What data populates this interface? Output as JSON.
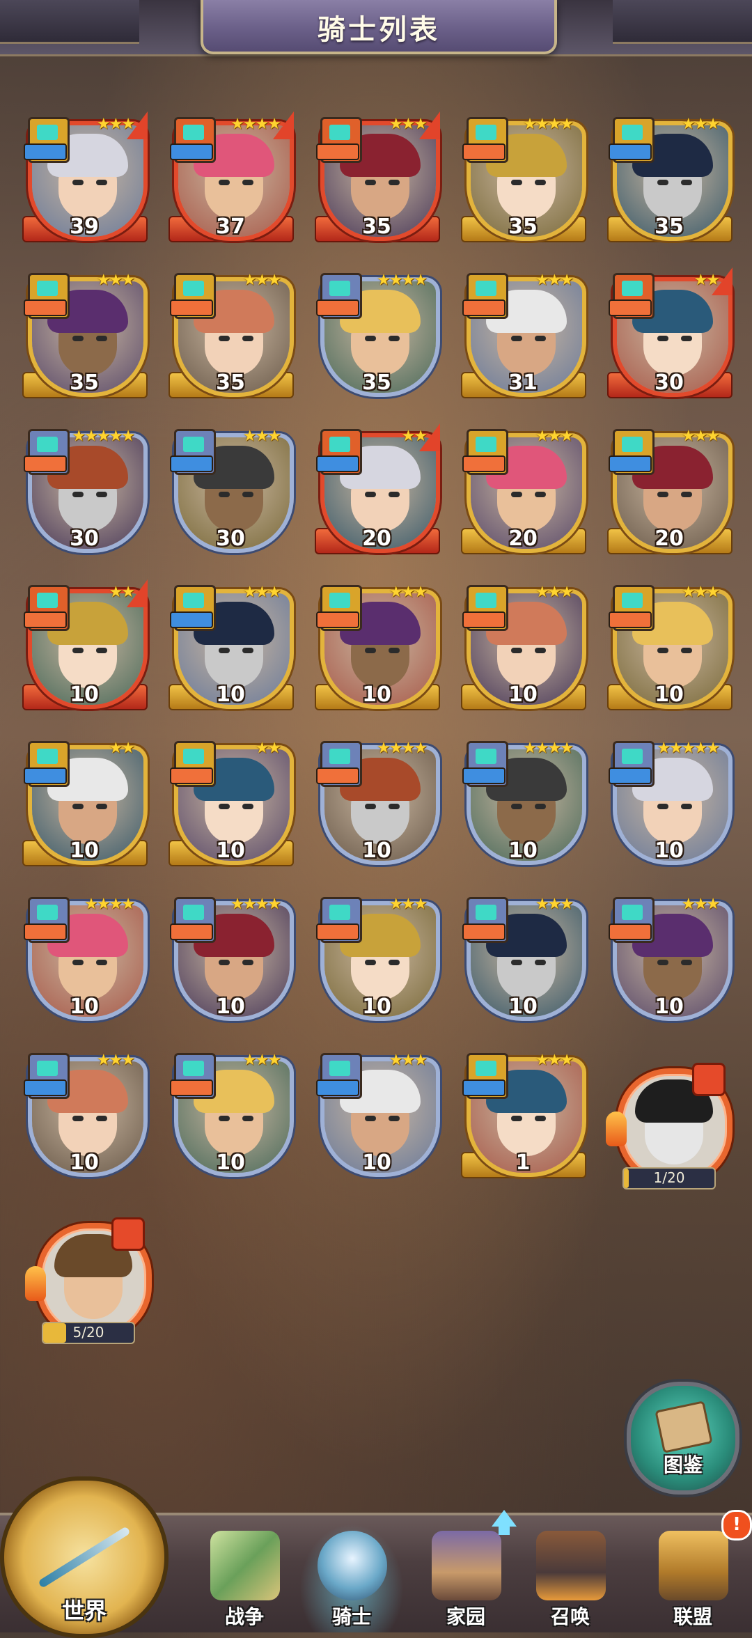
{
  "header": {
    "title": "骑士列表"
  },
  "colors": {
    "class_teal": "#3fd9c6",
    "tab_red": "#f0703a",
    "tab_blue": "#3f8ee0",
    "frame_gold": "#e3b43c",
    "frame_blue": "#9fb1d6",
    "frame_red": "#e24a2c"
  },
  "heroes": [
    {
      "level": "39",
      "stars": "★★★",
      "frame": "red",
      "tab": "blue",
      "class": "gold",
      "upgrade": true
    },
    {
      "level": "37",
      "stars": "★★★★",
      "frame": "red",
      "tab": "blue",
      "class": "red",
      "upgrade": true
    },
    {
      "level": "35",
      "stars": "★★★",
      "frame": "red",
      "tab": "red",
      "class": "red",
      "upgrade": true
    },
    {
      "level": "35",
      "stars": "★★★★",
      "frame": "gold",
      "tab": "red",
      "class": "gold",
      "upgrade": false
    },
    {
      "level": "35",
      "stars": "★★★",
      "frame": "gold",
      "tab": "blue",
      "class": "gold",
      "upgrade": false
    },
    {
      "level": "35",
      "stars": "★★★",
      "frame": "gold",
      "tab": "red",
      "class": "gold",
      "upgrade": false
    },
    {
      "level": "35",
      "stars": "★★★",
      "frame": "gold",
      "tab": "red",
      "class": "gold",
      "upgrade": false
    },
    {
      "level": "35",
      "stars": "★★★★",
      "frame": "blue",
      "tab": "red",
      "class": "blue",
      "upgrade": false
    },
    {
      "level": "31",
      "stars": "★★★",
      "frame": "gold",
      "tab": "red",
      "class": "gold",
      "upgrade": false
    },
    {
      "level": "30",
      "stars": "★★",
      "frame": "red",
      "tab": "red",
      "class": "red",
      "upgrade": true
    },
    {
      "level": "30",
      "stars": "★★★★★",
      "frame": "blue",
      "tab": "red",
      "class": "blue",
      "upgrade": false
    },
    {
      "level": "30",
      "stars": "★★★",
      "frame": "blue",
      "tab": "blue",
      "class": "blue",
      "upgrade": false
    },
    {
      "level": "20",
      "stars": "★★",
      "frame": "red",
      "tab": "blue",
      "class": "red",
      "upgrade": true
    },
    {
      "level": "20",
      "stars": "★★★",
      "frame": "gold",
      "tab": "red",
      "class": "gold",
      "upgrade": false
    },
    {
      "level": "20",
      "stars": "★★★",
      "frame": "gold",
      "tab": "blue",
      "class": "gold",
      "upgrade": false
    },
    {
      "level": "10",
      "stars": "★★",
      "frame": "red",
      "tab": "red",
      "class": "red",
      "upgrade": true
    },
    {
      "level": "10",
      "stars": "★★★",
      "frame": "gold",
      "tab": "blue",
      "class": "gold",
      "upgrade": false
    },
    {
      "level": "10",
      "stars": "★★★",
      "frame": "gold",
      "tab": "red",
      "class": "gold",
      "upgrade": false
    },
    {
      "level": "10",
      "stars": "★★★",
      "frame": "gold",
      "tab": "red",
      "class": "gold",
      "upgrade": false
    },
    {
      "level": "10",
      "stars": "★★★",
      "frame": "gold",
      "tab": "red",
      "class": "gold",
      "upgrade": false
    },
    {
      "level": "10",
      "stars": "★★",
      "frame": "gold",
      "tab": "blue",
      "class": "gold",
      "upgrade": false
    },
    {
      "level": "10",
      "stars": "★★",
      "frame": "gold",
      "tab": "red",
      "class": "gold",
      "upgrade": false
    },
    {
      "level": "10",
      "stars": "★★★★",
      "frame": "blue",
      "tab": "red",
      "class": "blue",
      "upgrade": false
    },
    {
      "level": "10",
      "stars": "★★★★",
      "frame": "blue",
      "tab": "blue",
      "class": "blue",
      "upgrade": false
    },
    {
      "level": "10",
      "stars": "★★★★★",
      "frame": "blue",
      "tab": "blue",
      "class": "blue",
      "upgrade": false
    },
    {
      "level": "10",
      "stars": "★★★★",
      "frame": "blue",
      "tab": "red",
      "class": "blue",
      "upgrade": false
    },
    {
      "level": "10",
      "stars": "★★★★",
      "frame": "blue",
      "tab": "red",
      "class": "blue",
      "upgrade": false
    },
    {
      "level": "10",
      "stars": "★★★",
      "frame": "blue",
      "tab": "red",
      "class": "blue",
      "upgrade": false
    },
    {
      "level": "10",
      "stars": "★★★",
      "frame": "blue",
      "tab": "red",
      "class": "blue",
      "upgrade": false
    },
    {
      "level": "10",
      "stars": "★★★",
      "frame": "blue",
      "tab": "red",
      "class": "blue",
      "upgrade": false
    },
    {
      "level": "10",
      "stars": "★★★",
      "frame": "blue",
      "tab": "blue",
      "class": "blue",
      "upgrade": false
    },
    {
      "level": "10",
      "stars": "★★★",
      "frame": "blue",
      "tab": "red",
      "class": "blue",
      "upgrade": false
    },
    {
      "level": "10",
      "stars": "★★★",
      "frame": "blue",
      "tab": "blue",
      "class": "blue",
      "upgrade": false
    },
    {
      "level": "1",
      "stars": "★★★",
      "frame": "gold",
      "tab": "blue",
      "class": "gold",
      "upgrade": false
    }
  ],
  "shards": [
    {
      "progress": "1/20",
      "fraction": 0.05
    },
    {
      "progress": "5/20",
      "fraction": 0.25
    }
  ],
  "codex": {
    "label": "图鉴",
    "icon": "book-icon"
  },
  "nav": {
    "world": "世界",
    "battle": "战争",
    "knight": "骑士",
    "home": "家园",
    "summon": "召唤",
    "alliance": "联盟",
    "alert": "!"
  }
}
